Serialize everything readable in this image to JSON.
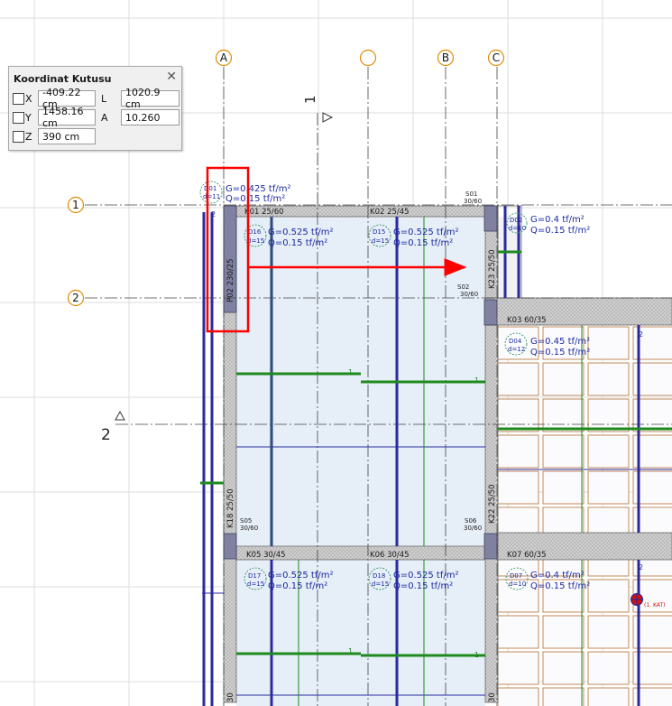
{
  "coord_box": {
    "title": "Koordinat Kutusu",
    "x_label": "X",
    "x_value": "-409.22 cm",
    "y_label": "Y",
    "y_value": "1458.16 cm",
    "z_label": "Z",
    "z_value": "390 cm",
    "l_label": "L",
    "l_value": "1020.9 cm",
    "a_label": "A",
    "a_value": "10.260"
  },
  "axes": {
    "a": "A",
    "b": "B",
    "c": "C",
    "one": "1",
    "two": "2"
  },
  "sections": {
    "one": "1",
    "two": "2"
  },
  "columns": {
    "s01": "S01",
    "s02": "S02",
    "s05": "S05",
    "s06": "S06",
    "size": "30/60"
  },
  "beams": {
    "k01": "K01 25/60",
    "k02": "K02 25/45",
    "k03": "K03 60/35",
    "k05": "K05 30/45",
    "k06": "K06 30/45",
    "k07": "K07 60/35",
    "k18": "K18 25/50",
    "k22": "K22 25/50",
    "k23": "K23 25/50",
    "p02": "P02 230/25",
    "k30a": "30",
    "k30b": "30"
  },
  "slabs": {
    "d01": {
      "id": "D01",
      "d": "d=11",
      "g": "G=0.425 tf/m²",
      "q": "Q=0.15 tf/m²"
    },
    "d16": {
      "id": "D16",
      "d": "d=15",
      "g": "G=0.525 tf/m²",
      "q": "Q=0.15 tf/m²"
    },
    "d15": {
      "id": "D15",
      "d": "d=15",
      "g": "G=0.525 tf/m²",
      "q": "Q=0.15 tf/m²"
    },
    "d02": {
      "id": "D02",
      "d": "d=10",
      "g": "G=0.4 tf/m²",
      "q": "Q=0.15 tf/m²"
    },
    "d04": {
      "id": "D04",
      "d": "d=12",
      "g": "G=0.45 tf/m²",
      "q": "Q=0.15 tf/m²"
    },
    "d17": {
      "id": "D17",
      "d": "d=15",
      "g": "G=0.525 tf/m²",
      "q": "Q=0.15 tf/m²"
    },
    "d18": {
      "id": "D18",
      "d": "d=15",
      "g": "G=0.525 tf/m²",
      "q": "Q=0.15 tf/m²"
    },
    "d07": {
      "id": "D07",
      "d": "d=10",
      "g": "G=0.4 tf/m²",
      "q": "Q=0.15 tf/m²"
    }
  },
  "marks": {
    "one": "1",
    "two": "2",
    "kat": "(1. KAT)"
  },
  "colors": {
    "grid_bg": "#dcdcdc",
    "slab_fill": "#e6eef7",
    "rebar_blue": "#2a2a9c",
    "rebar_green": "#1e8a1e",
    "highlight": "#ff0000",
    "axis_bubble": "#e08a00",
    "text_blue": "#1c2aa0",
    "tile": "#c08a5a"
  }
}
